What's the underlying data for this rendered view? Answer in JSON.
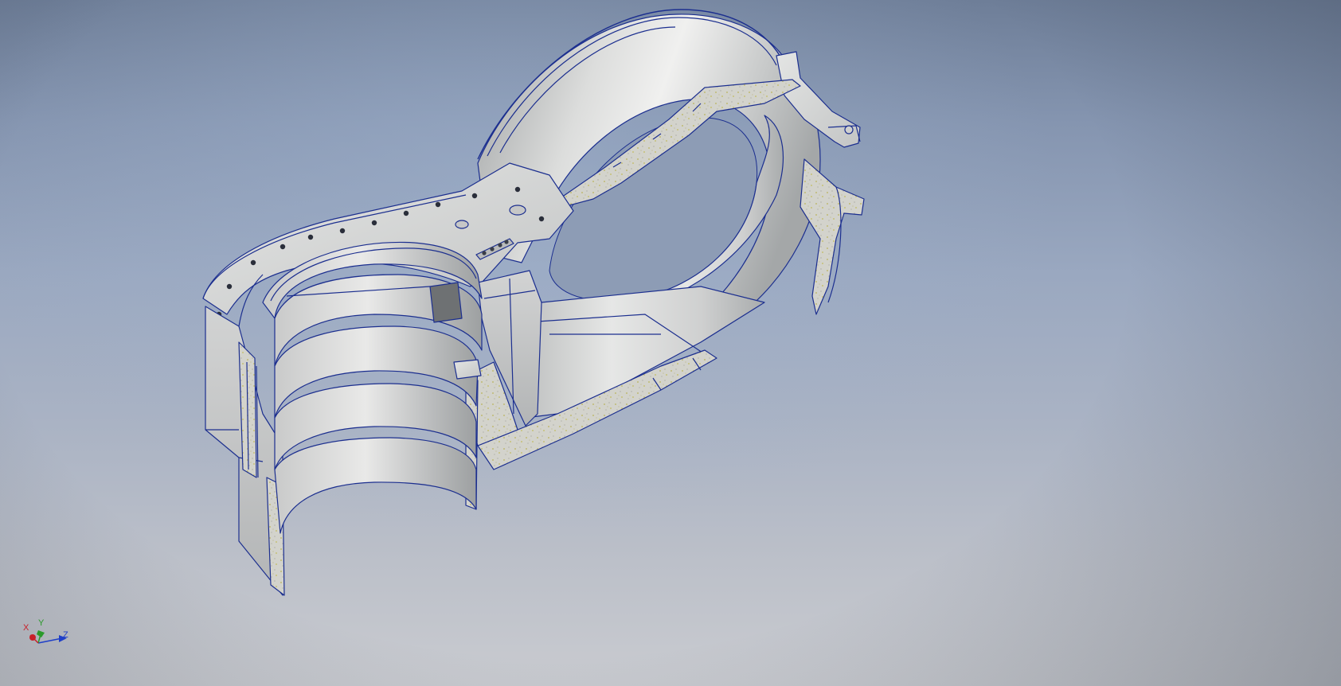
{
  "viewport": {
    "background_top": "#6e7e98",
    "background_bottom": "#c9cbd0",
    "model_color": "#d6d7d6",
    "edge_color": "#1c2f8f"
  },
  "triad": {
    "x_label": "X",
    "y_label": "Y",
    "z_label": "Z",
    "x_color": "#c8202a",
    "y_color": "#2a9a2a",
    "z_color": "#1f3fc8"
  }
}
